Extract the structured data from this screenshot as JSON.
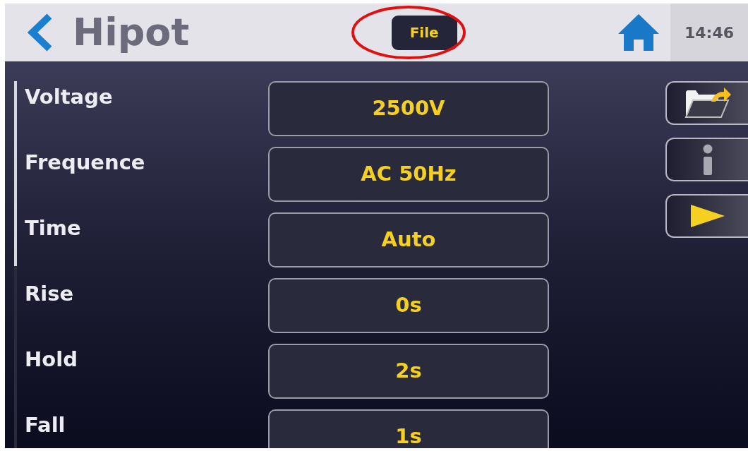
{
  "header": {
    "title": "Hipot",
    "file_button": "File",
    "time": "14:46"
  },
  "parameters": [
    {
      "label": "Voltage",
      "value": "2500V"
    },
    {
      "label": "Frequence",
      "value": "AC 50Hz"
    },
    {
      "label": "Time",
      "value": "Auto"
    },
    {
      "label": "Rise",
      "value": "0s"
    },
    {
      "label": "Hold",
      "value": "2s"
    },
    {
      "label": "Fall",
      "value": "1s"
    }
  ]
}
